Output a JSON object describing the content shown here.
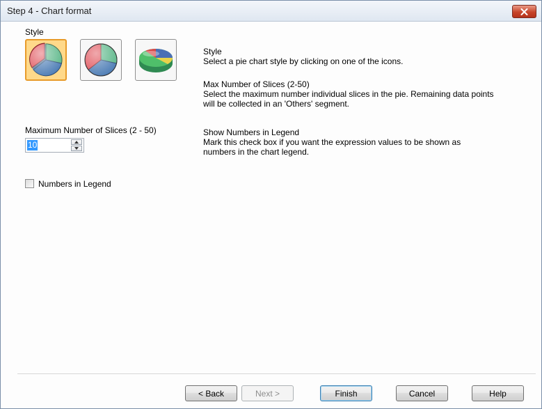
{
  "window": {
    "title": "Step 4 - Chart format"
  },
  "left": {
    "style_label": "Style",
    "style_icons": [
      "pie-2d-exploded-style-icon",
      "pie-2d-style-icon",
      "pie-3d-style-icon"
    ],
    "max_slices_label": "Maximum Number of Slices (2 - 50)",
    "max_slices_value": "10",
    "numbers_in_legend_label": "Numbers in Legend",
    "numbers_in_legend_checked": false
  },
  "help": {
    "style_heading": "Style",
    "style_text": "Select a pie chart style by clicking on one of the icons.",
    "max_heading": "Max Number of Slices (2-50)",
    "max_text_1": "Select the maximum number individual slices in the pie. Remaining data points",
    "max_text_2": "will be collected in an 'Others' segment.",
    "legend_heading": "Show Numbers in Legend",
    "legend_text_1": "Mark this check box if you want the expression values to be shown as",
    "legend_text_2": "numbers in the chart legend."
  },
  "buttons": {
    "back": "< Back",
    "next": "Next >",
    "finish": "Finish",
    "cancel": "Cancel",
    "help": "Help"
  },
  "colors": {
    "pie_red": "#e0525a",
    "pie_green": "#5db88a",
    "pie_blue": "#4f7eb6",
    "selected_highlight": "#ffd98a"
  }
}
